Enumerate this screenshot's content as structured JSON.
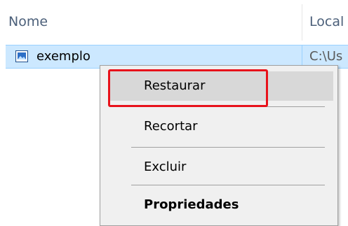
{
  "header": {
    "col_name": "Nome",
    "col_location": "Local"
  },
  "file": {
    "name": "exemplo",
    "location": "C:\\Us",
    "icon": "image-file-icon"
  },
  "context_menu": {
    "items": [
      {
        "label": "Restaurar",
        "highlighted": true
      },
      {
        "label": "Recortar"
      },
      {
        "label": "Excluir"
      },
      {
        "label": "Propriedades",
        "bold": true
      }
    ]
  },
  "colors": {
    "selection": "#cce8ff",
    "annotation": "#e8121b",
    "menu_bg": "#f0f0f0"
  }
}
